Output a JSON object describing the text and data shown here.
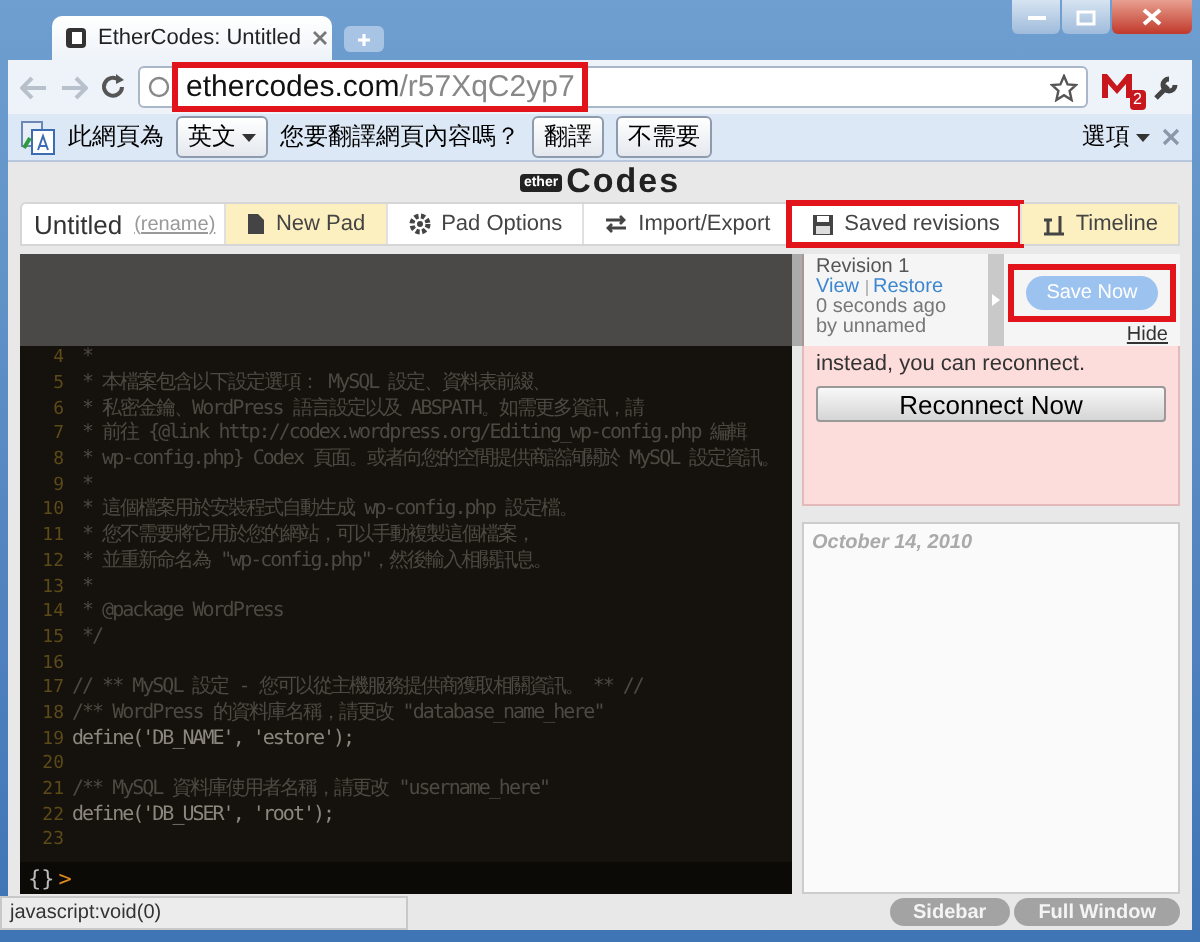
{
  "browser": {
    "tab_title": "EtherCodes: Untitled",
    "url_host": "ethercodes.com",
    "url_path": "/r57XqC2yp7",
    "url_annotated": true,
    "mail_count": "2"
  },
  "translate_bar": {
    "prefix": "此網頁為",
    "language": "英文",
    "question": "您要翻譯網頁內容嗎？",
    "buttons": [
      "翻譯",
      "不需要"
    ],
    "options": "選項"
  },
  "logo": {
    "badge": "ether",
    "name": "Codes"
  },
  "pad": {
    "title": "Untitled",
    "rename": "(rename)"
  },
  "toolbar": [
    {
      "label": "New Pad",
      "kind": "page",
      "accent": true,
      "annotated": false
    },
    {
      "label": "Pad Options",
      "kind": "gear",
      "accent": false,
      "annotated": false
    },
    {
      "label": "Import/Export",
      "kind": "arrows",
      "accent": false,
      "annotated": false
    },
    {
      "label": "Saved revisions",
      "kind": "floppy",
      "accent": false,
      "annotated": true
    },
    {
      "label": "Timeline",
      "kind": "timeline",
      "accent": true,
      "annotated": false
    }
  ],
  "editor": {
    "lines": [
      {
        "number": "4",
        "kind": "comment",
        "text": " *"
      },
      {
        "number": "5",
        "kind": "comment",
        "text": " * 本檔案包含以下設定選項： MySQL 設定、資料表前綴、"
      },
      {
        "number": "6",
        "kind": "comment",
        "text": " * 私密金鑰、WordPress 語言設定以及 ABSPATH。如需更多資訊，請"
      },
      {
        "number": "7",
        "kind": "comment",
        "text": " * 前往 {@link http://codex.wordpress.org/Editing_wp-config.php 編輯"
      },
      {
        "number": "8",
        "kind": "comment",
        "text": " * wp-config.php} Codex 頁面。或者向您的空間提供商諮詢關於 MySQL 設定資訊。"
      },
      {
        "number": "9",
        "kind": "comment",
        "text": " *"
      },
      {
        "number": "10",
        "kind": "comment",
        "text": " * 這個檔案用於安裝程式自動生成 wp-config.php 設定檔。"
      },
      {
        "number": "11",
        "kind": "comment",
        "text": " * 您不需要將它用於您的網站，可以手動複製這個檔案，"
      },
      {
        "number": "12",
        "kind": "comment",
        "text": " * 並重新命名為 \"wp-config.php\"，然後輸入相關訊息。"
      },
      {
        "number": "13",
        "kind": "comment",
        "text": " *"
      },
      {
        "number": "14",
        "kind": "comment",
        "text": " * @package WordPress"
      },
      {
        "number": "15",
        "kind": "comment",
        "text": " */"
      },
      {
        "number": "16"
      },
      {
        "number": "17",
        "kind": "comment",
        "text": "// ** MySQL 設定 - 您可以從主機服務提供商獲取相關資訊。 ** //"
      },
      {
        "number": "18",
        "kind": "comment",
        "text": "/** WordPress 的資料庫名稱，請更改 \"database_name_here\""
      },
      {
        "number": "19",
        "kind": "code",
        "text": "define('DB_NAME', 'estore');"
      },
      {
        "number": "20"
      },
      {
        "number": "21",
        "kind": "comment",
        "text": "/** MySQL 資料庫使用者名稱，請更改 \"username_here\""
      },
      {
        "number": "22",
        "kind": "code",
        "text": "define('DB_USER', 'root');"
      },
      {
        "number": "23"
      }
    ],
    "prompt_braces": "{}",
    "prompt_caret": ">"
  },
  "revisions": {
    "items": [
      {
        "title": "Revision 1",
        "view": "View",
        "restore": "Restore",
        "time": "0 seconds ago",
        "author": "by unnamed"
      }
    ],
    "save_button": "Save Now",
    "save_annotated": true,
    "hide": "Hide"
  },
  "connection": {
    "message": "instead, you can reconnect.",
    "button": "Reconnect Now"
  },
  "chat": {
    "date": "October 14, 2010"
  },
  "footer_buttons": [
    "Sidebar",
    "Full Window"
  ],
  "status_bubble": "javascript:void(0)"
}
